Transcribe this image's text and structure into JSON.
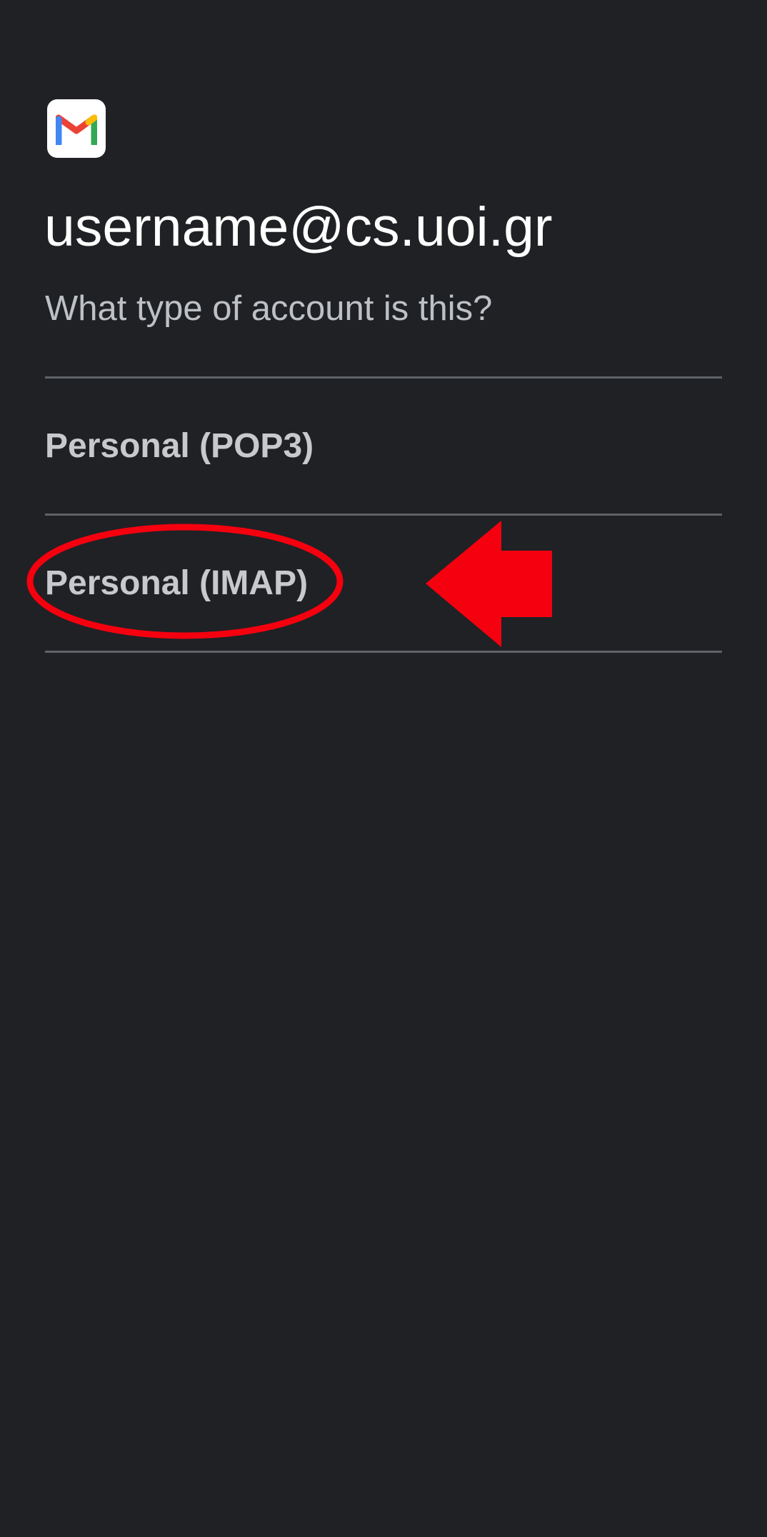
{
  "app": {
    "icon": "gmail-logo-icon",
    "brand_colors": {
      "red": "#ea4335",
      "blue": "#4285f4",
      "green": "#34a853",
      "yellow": "#fbbc04"
    }
  },
  "header": {
    "account_email": "username@cs.uoi.gr",
    "prompt": "What type of account is this?"
  },
  "options": [
    {
      "label": "Personal (POP3)"
    },
    {
      "label": "Personal (IMAP)"
    }
  ],
  "annotation": {
    "color": "#f5000f",
    "highlight_shape": "ellipse",
    "pointer_icon": "left-arrow-icon",
    "highlighted_option": "Personal (IMAP)"
  }
}
